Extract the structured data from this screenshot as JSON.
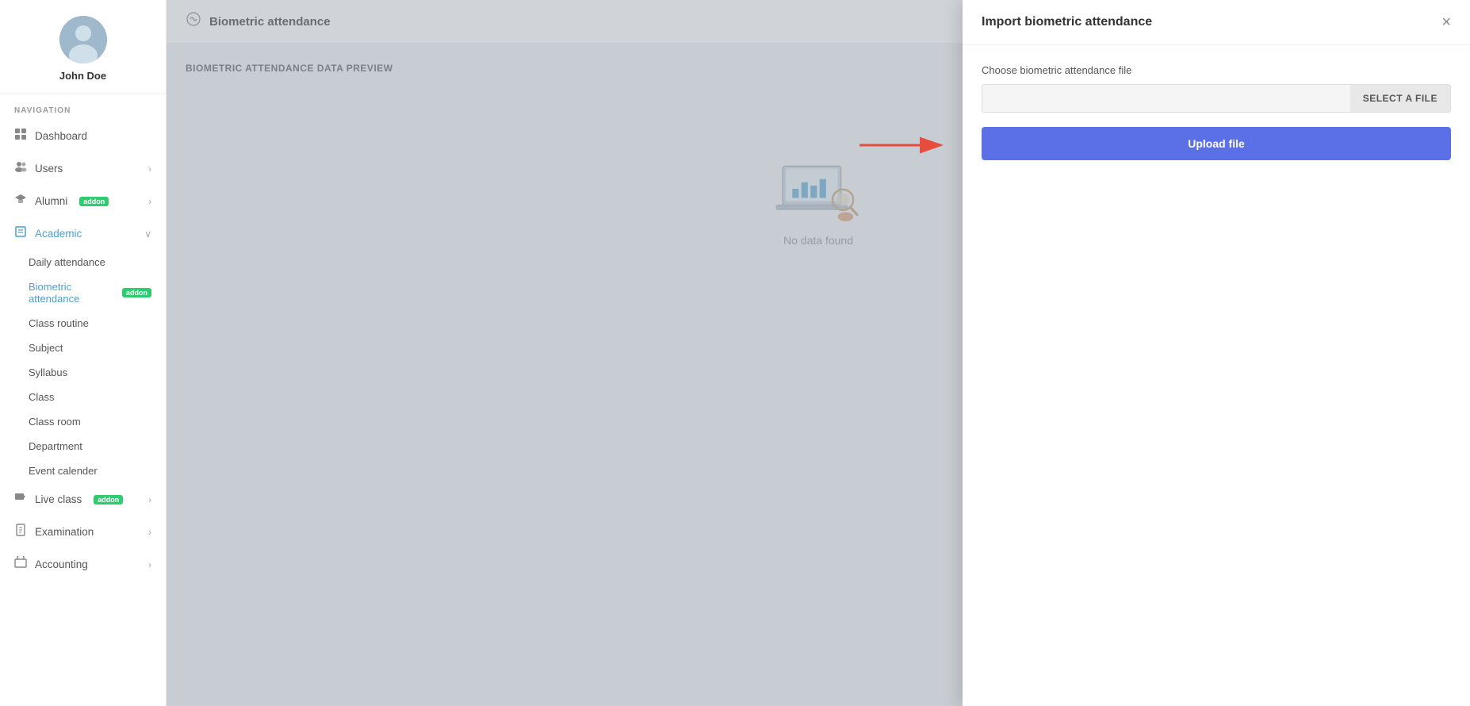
{
  "sidebar": {
    "user": {
      "name": "John Doe"
    },
    "nav_label": "NAVIGATION",
    "items": [
      {
        "id": "dashboard",
        "label": "Dashboard",
        "icon": "📊",
        "hasChevron": false
      },
      {
        "id": "users",
        "label": "Users",
        "icon": "👤",
        "hasChevron": true
      },
      {
        "id": "alumni",
        "label": "Alumni",
        "icon": "🎓",
        "hasChevron": true,
        "addon": true
      },
      {
        "id": "academic",
        "label": "Academic",
        "icon": "📋",
        "hasChevron": true,
        "expanded": true
      },
      {
        "id": "live-class",
        "label": "Live class",
        "icon": "🎥",
        "hasChevron": true,
        "addon": true
      },
      {
        "id": "examination",
        "label": "Examination",
        "icon": "📅",
        "hasChevron": true
      },
      {
        "id": "accounting",
        "label": "Accounting",
        "icon": "👜",
        "hasChevron": true
      }
    ],
    "academic_sub_items": [
      {
        "id": "daily-attendance",
        "label": "Daily attendance",
        "active": false
      },
      {
        "id": "biometric-attendance",
        "label": "Biometric attendance",
        "active": true,
        "addon": true
      },
      {
        "id": "class-routine",
        "label": "Class routine",
        "active": false
      },
      {
        "id": "subject",
        "label": "Subject",
        "active": false
      },
      {
        "id": "syllabus",
        "label": "Syllabus",
        "active": false
      },
      {
        "id": "class",
        "label": "Class",
        "active": false
      },
      {
        "id": "class-room",
        "label": "Class room",
        "active": false
      },
      {
        "id": "department",
        "label": "Department",
        "active": false
      },
      {
        "id": "event-calender",
        "label": "Event calender",
        "active": false
      }
    ]
  },
  "main": {
    "page_title": "Biometric attendance",
    "section_title": "BIOMETRIC ATTENDANCE DATA PREVIEW",
    "no_data_text": "No data found"
  },
  "modal": {
    "title": "Import biometric attendance",
    "close_label": "×",
    "form_label": "Choose biometric attendance file",
    "file_placeholder": "",
    "select_file_btn": "SELECT A FILE",
    "upload_btn": "Upload file"
  }
}
